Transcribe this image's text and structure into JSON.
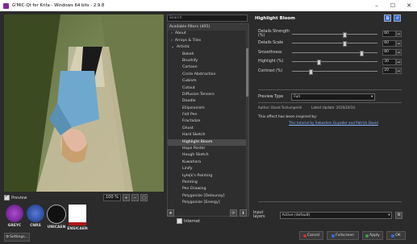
{
  "window": {
    "title": "G'MIC-Qt for Krita - Windows 64 bits - 2.9.8",
    "controls": [
      "–",
      "☐",
      "✕"
    ]
  },
  "preview": {
    "checkbox_label": "Preview",
    "zoom_value": "100 %"
  },
  "logos": [
    {
      "label": "GREYC",
      "color": "#7b2b9c"
    },
    {
      "label": "CNRS",
      "color": "#2a4a9a"
    },
    {
      "label": "UNICAEN",
      "color": "#111111"
    },
    {
      "label": "ENSICAEN",
      "color": "#b01818"
    }
  ],
  "settings_label": "Settings...",
  "filters": {
    "search_placeholder": "Search",
    "header": "Available filters (405)",
    "rows": [
      {
        "type": "cat",
        "label": "About",
        "arrow": "›"
      },
      {
        "type": "cat",
        "label": "Arrays & Tiles",
        "arrow": "›"
      },
      {
        "type": "cat",
        "label": "Artistic",
        "arrow": "⌄"
      },
      {
        "type": "item",
        "label": "Bokeh"
      },
      {
        "type": "item",
        "label": "Brushify"
      },
      {
        "type": "item",
        "label": "Cartoon"
      },
      {
        "type": "item",
        "label": "Circle Abstraction"
      },
      {
        "type": "item",
        "label": "Cubism"
      },
      {
        "type": "item",
        "label": "Cutout"
      },
      {
        "type": "item",
        "label": "Diffusion Tensors"
      },
      {
        "type": "item",
        "label": "Doodle"
      },
      {
        "type": "item",
        "label": "Ellipsionism"
      },
      {
        "type": "item",
        "label": "Felt Pen"
      },
      {
        "type": "item",
        "label": "Fractalize"
      },
      {
        "type": "item",
        "label": "Ghost"
      },
      {
        "type": "item",
        "label": "Hard Sketch"
      },
      {
        "type": "item",
        "label": "Highlight Bloom",
        "selected": true
      },
      {
        "type": "item",
        "label": "Hope Poster"
      },
      {
        "type": "item",
        "label": "Hough Sketch"
      },
      {
        "type": "item",
        "label": "Kuwahara"
      },
      {
        "type": "item",
        "label": "Linify"
      },
      {
        "type": "item",
        "label": "Lylejk's Painting"
      },
      {
        "type": "item",
        "label": "Painting"
      },
      {
        "type": "item",
        "label": "Pen Drawing"
      },
      {
        "type": "item",
        "label": "Polygonize [Delaunay]"
      },
      {
        "type": "item",
        "label": "Polygonize [Energy]"
      }
    ],
    "internet_label": "Internet"
  },
  "params": {
    "title": "Highlight Bloom",
    "sliders": [
      {
        "label": "Details Strength (%)",
        "value": "60",
        "fraction": 0.6
      },
      {
        "label": "Details Scale",
        "value": "60",
        "fraction": 0.6
      },
      {
        "label": "Smoothness",
        "value": "80",
        "fraction": 0.8
      },
      {
        "label": "Highlight (%)",
        "value": "30",
        "fraction": 0.3
      },
      {
        "label": "Contrast (%)",
        "value": "20",
        "fraction": 0.2
      }
    ],
    "preview_type_label": "Preview Type",
    "preview_type_value": "Full",
    "author": "Author: David Tschumperlé",
    "latest_update": "Latest Update: 2016/24/10.",
    "inspired_text": "This effect has been inspired by:",
    "inspired_link": "This tutorial by Sebastien Guyader and Patrick David"
  },
  "input_layers": {
    "label": "Input layers",
    "value": "Active (default)"
  },
  "actions": {
    "cancel": "Cancel",
    "fullscreen": "Fullscreen",
    "apply": "Apply",
    "ok": "OK"
  },
  "colors": {
    "background": "#2b2b2b",
    "selection": "#4a4a4a",
    "link": "#8ab4ff"
  }
}
